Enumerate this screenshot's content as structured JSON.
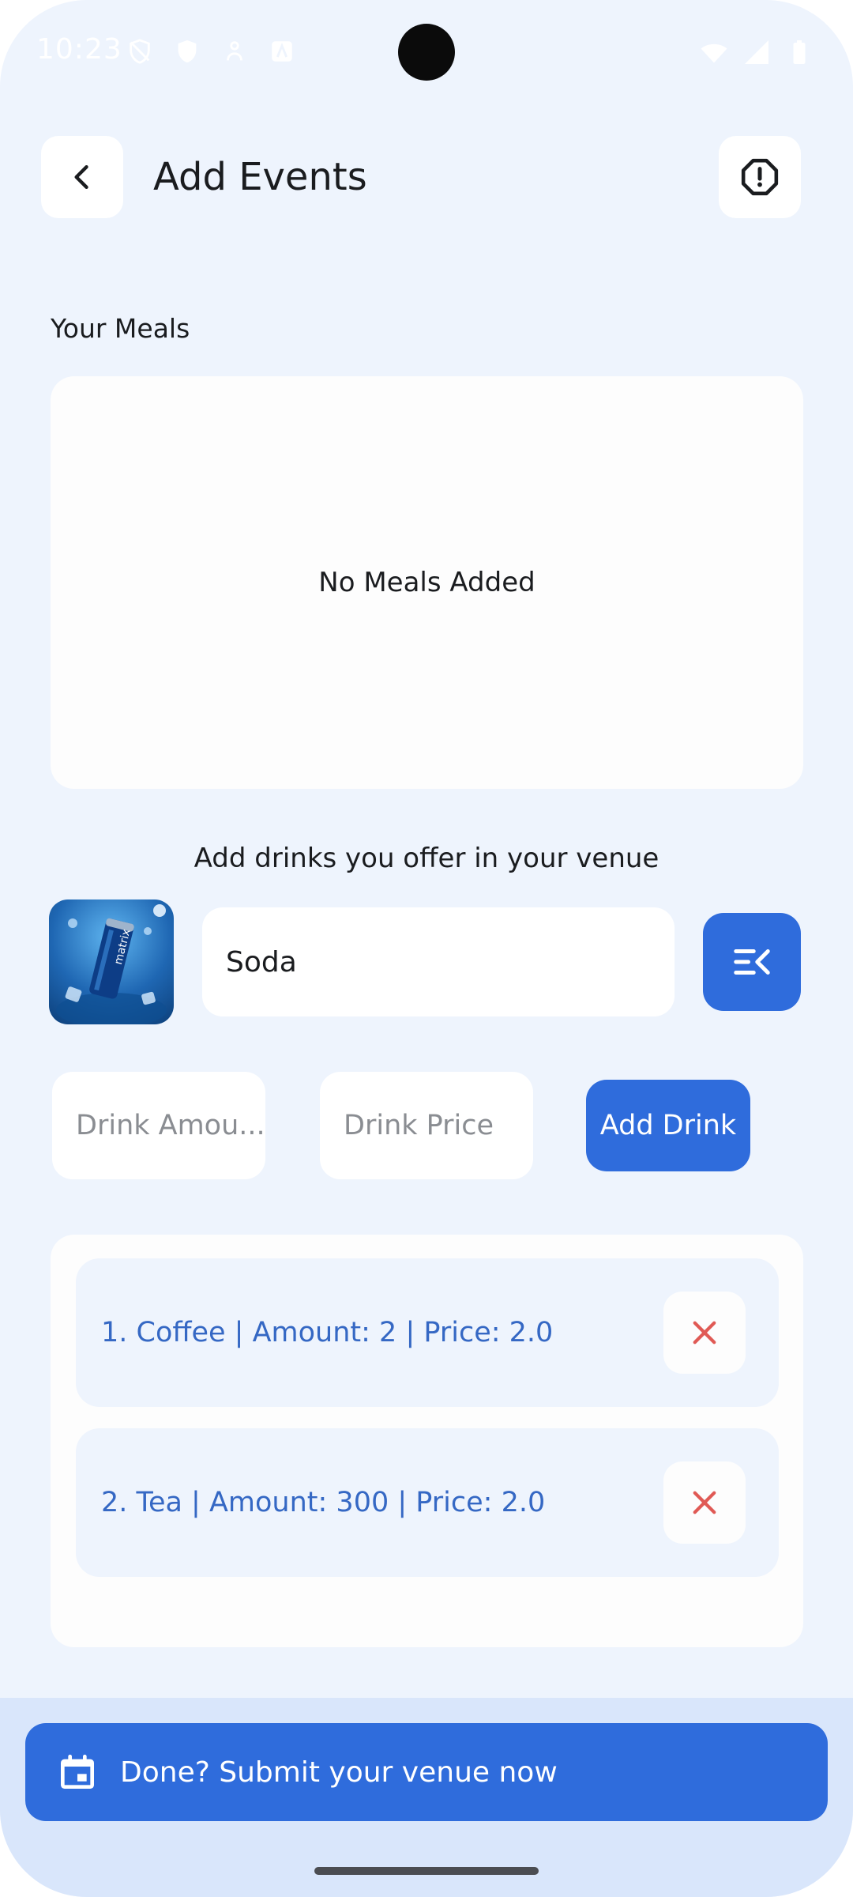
{
  "status_bar": {
    "time": "10:23"
  },
  "header": {
    "title": "Add Events",
    "back_icon": "chevron-left-icon",
    "report_icon": "alert-octagon-icon"
  },
  "meals": {
    "label": "Your Meals",
    "empty_text": "No Meals Added"
  },
  "drinks": {
    "heading": "Add drinks you offer in your venue",
    "name_value": "Soda",
    "amount_placeholder": "Drink Amou...",
    "price_placeholder": "Drink Price",
    "add_button_label": "Add Drink",
    "items": [
      {
        "text": "1. Coffee | Amount: 2 | Price: 2.0"
      },
      {
        "text": "2. Tea | Amount: 300 | Price: 2.0"
      }
    ]
  },
  "footer": {
    "submit_label": "Done? Submit your venue now"
  },
  "colors": {
    "accent": "#2f6cdc",
    "background": "#eef4fd",
    "remove": "#e05a55",
    "item_text": "#3568c4"
  }
}
